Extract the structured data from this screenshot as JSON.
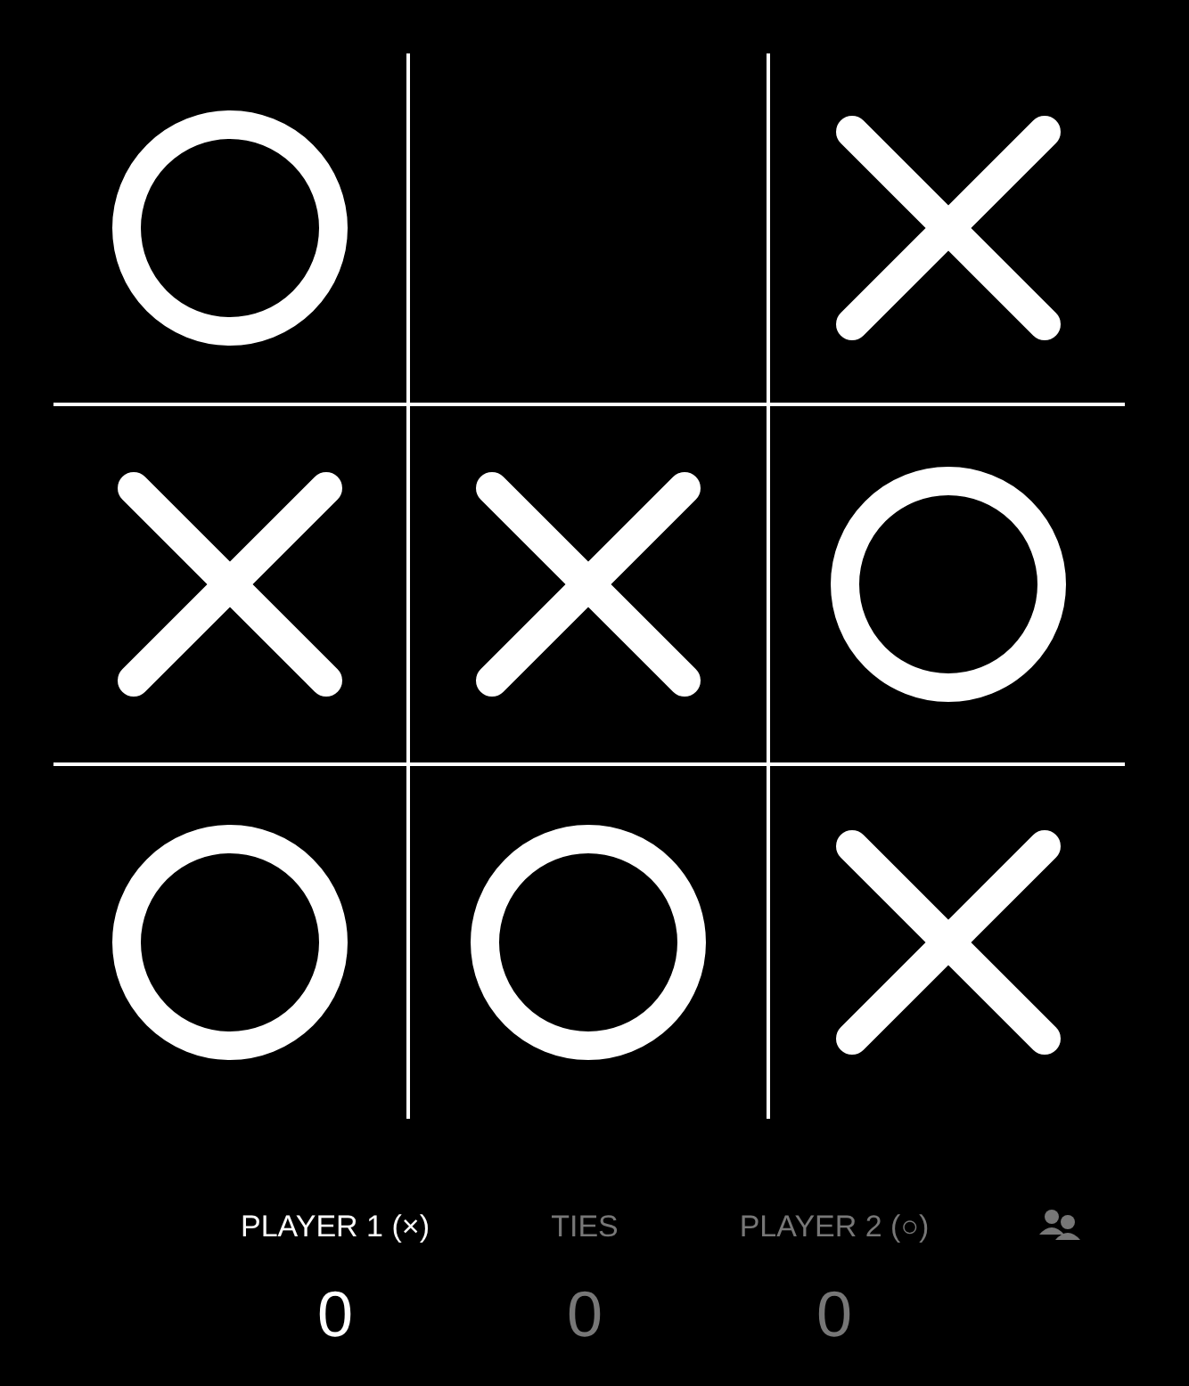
{
  "board": {
    "cells": [
      {
        "kind": "o"
      },
      {
        "kind": "empty"
      },
      {
        "kind": "x"
      },
      {
        "kind": "x"
      },
      {
        "kind": "x"
      },
      {
        "kind": "o"
      },
      {
        "kind": "o"
      },
      {
        "kind": "o"
      },
      {
        "kind": "x"
      }
    ]
  },
  "scores": [
    {
      "label": "PLAYER 1 (×)",
      "value": "0",
      "selected": true
    },
    {
      "label": "TIES",
      "value": "0",
      "selected": false
    },
    {
      "label": "PLAYER 2 (○)",
      "value": "0",
      "selected": false
    }
  ]
}
